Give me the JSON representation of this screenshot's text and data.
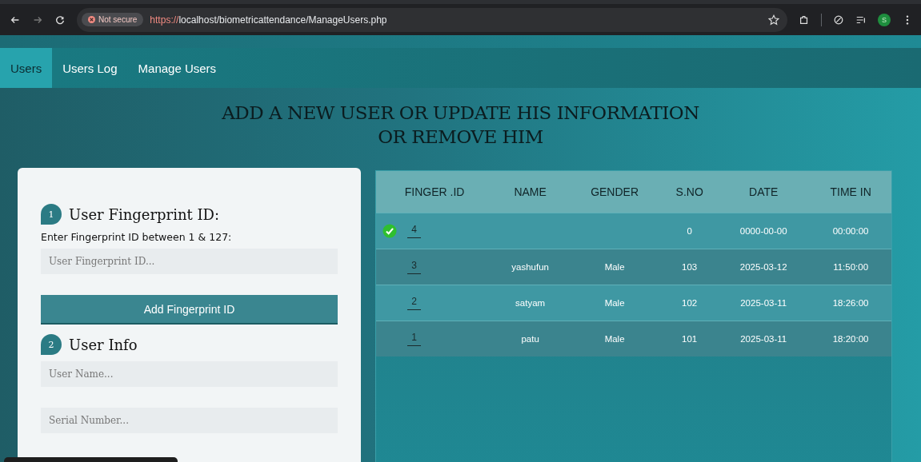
{
  "browser": {
    "security_label": "Not secure",
    "url_scheme": "https://",
    "url_rest": "localhost/biometricattendance/ManageUsers.php",
    "profile_initial": "S"
  },
  "nav": [
    {
      "label": "Users",
      "selected": true
    },
    {
      "label": "Users Log",
      "selected": false
    },
    {
      "label": "Manage Users",
      "selected": false
    }
  ],
  "heading": [
    "ADD A NEW USER OR UPDATE HIS INFORMATION",
    "OR REMOVE HIM"
  ],
  "form": {
    "step1": {
      "number": "1",
      "title": "User Fingerprint ID:"
    },
    "hint": "Enter Fingerprint ID between 1 & 127:",
    "id_field": {
      "placeholder": "User Fingerprint ID..."
    },
    "add_button": "Add Fingerprint ID",
    "step2": {
      "number": "2",
      "title": "User Info"
    },
    "name_field": {
      "placeholder": "User Name..."
    },
    "serial_field": {
      "placeholder": "Serial Number..."
    }
  },
  "table": {
    "columns": [
      "FINGER .ID",
      "NAME",
      "GENDER",
      "S.NO",
      "DATE",
      "TIME IN"
    ],
    "rows": [
      {
        "selected": true,
        "finger_id": "4",
        "name": "",
        "gender": "",
        "sno": "0",
        "date": "0000-00-00",
        "time_in": "00:00:00"
      },
      {
        "selected": false,
        "finger_id": "3",
        "name": "yashufun",
        "gender": "Male",
        "sno": "103",
        "date": "2025-03-12",
        "time_in": "11:50:00"
      },
      {
        "selected": false,
        "finger_id": "2",
        "name": "satyam",
        "gender": "Male",
        "sno": "102",
        "date": "2025-03-11",
        "time_in": "18:26:00"
      },
      {
        "selected": false,
        "finger_id": "1",
        "name": "patu",
        "gender": "Male",
        "sno": "101",
        "date": "2025-03-11",
        "time_in": "18:20:00"
      }
    ]
  }
}
